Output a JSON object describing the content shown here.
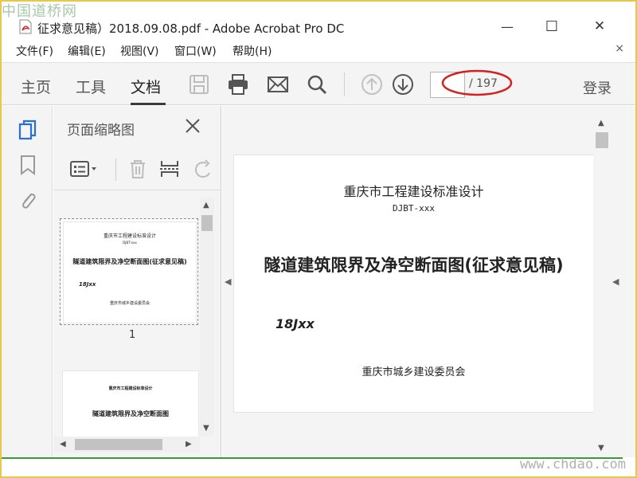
{
  "watermarks": {
    "top": "中国道桥网",
    "bottom": "www.chdao.com"
  },
  "window": {
    "title": "征求意见稿）2018.09.08.pdf - Adobe Acrobat Pro DC",
    "controls": {
      "minimize": "—",
      "maximize": "☐",
      "close": "✕"
    }
  },
  "menu": {
    "items": [
      "文件(F)",
      "编辑(E)",
      "视图(V)",
      "窗口(W)",
      "帮助(H)"
    ],
    "close": "×"
  },
  "toolbar": {
    "tabs": [
      "主页",
      "工具",
      "文档"
    ],
    "active_tab": "文档",
    "page_input_value": "",
    "page_total": "/ 197",
    "login": "登录"
  },
  "thumbnails": {
    "title": "页面缩略图",
    "page_number": "1",
    "thumb1": {
      "header": "重庆市工程建设标准设计",
      "code": "DJBT-xxx",
      "title": "隧道建筑限界及净空断面图(征求意见稿)",
      "number": "18Jxx",
      "issuer": "重庆市城乡建设委员会"
    },
    "thumb2": {
      "header": "重庆市工程建设标准设计",
      "title": "隧道建筑限界及净空断面图"
    }
  },
  "document": {
    "header": "重庆市工程建设标准设计",
    "code": "DJBT-xxx",
    "title": "隧道建筑限界及净空断面图(征求意见稿)",
    "number": "18Jxx",
    "issuer": "重庆市城乡建设委员会"
  },
  "colors": {
    "accent_blue": "#2a6fd6",
    "annotation_red": "#d42020",
    "bottom_line": "#3a9a3a"
  }
}
